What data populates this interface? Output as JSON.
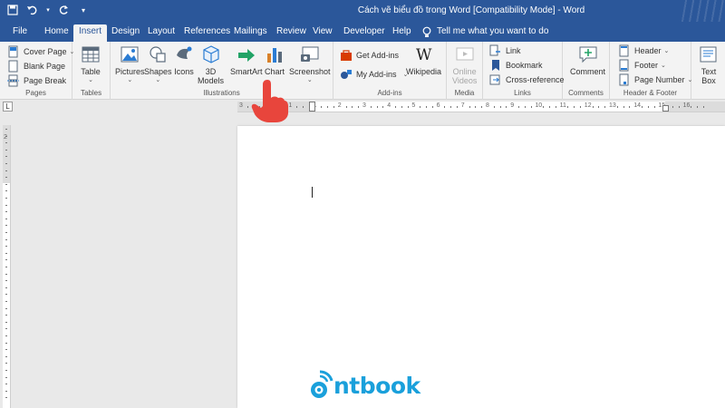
{
  "window": {
    "title": "Cách vẽ biểu đồ trong Word [Compatibility Mode]  -  Word"
  },
  "tabs": [
    {
      "label": "File"
    },
    {
      "label": "Home"
    },
    {
      "label": "Insert",
      "active": true
    },
    {
      "label": "Design"
    },
    {
      "label": "Layout"
    },
    {
      "label": "References"
    },
    {
      "label": "Mailings"
    },
    {
      "label": "Review"
    },
    {
      "label": "View"
    },
    {
      "label": "Developer"
    },
    {
      "label": "Help"
    }
  ],
  "tell_me": "Tell me what you want to do",
  "ribbon": {
    "pages": {
      "label": "Pages",
      "cover_page": "Cover Page",
      "blank_page": "Blank Page",
      "page_break": "Page Break"
    },
    "tables": {
      "label": "Tables",
      "table": "Table"
    },
    "illustrations": {
      "label": "Illustrations",
      "pictures": "Pictures",
      "shapes": "Shapes",
      "icons": "Icons",
      "models_3d_line1": "3D",
      "models_3d_line2": "Models",
      "smartart": "SmartArt",
      "chart": "Chart",
      "screenshot": "Screenshot"
    },
    "addins": {
      "label": "Add-ins",
      "get_addins": "Get Add-ins",
      "my_addins": "My Add-ins",
      "wikipedia": "Wikipedia"
    },
    "media": {
      "label": "Media",
      "online_line1": "Online",
      "online_line2": "Videos"
    },
    "links": {
      "label": "Links",
      "link": "Link",
      "bookmark": "Bookmark",
      "cross_reference": "Cross-reference"
    },
    "comments": {
      "label": "Comments",
      "comment": "Comment"
    },
    "header_footer": {
      "label": "Header & Footer",
      "header": "Header",
      "footer": "Footer",
      "page_number": "Page Number"
    },
    "text": {
      "text_line1": "Text",
      "text_line2": "Box"
    }
  },
  "ruler": {
    "corner": "L",
    "numbers": [
      "3",
      "2",
      "1",
      "1",
      "2",
      "3",
      "4",
      "5",
      "6",
      "7",
      "8",
      "9",
      "10",
      "11",
      "12",
      "13",
      "14",
      "15",
      "16"
    ]
  },
  "logo": {
    "text": "ntbook"
  },
  "colors": {
    "word_blue": "#2b579a",
    "pointer_red": "#e8453c",
    "logo_blue": "#1aa0db"
  }
}
